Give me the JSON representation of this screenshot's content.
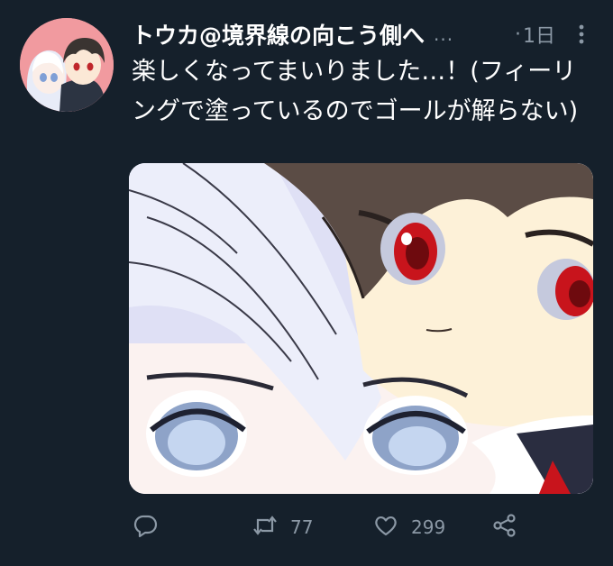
{
  "tweet": {
    "author_name": "トウカ@境界線の向こう側へ",
    "name_overflow": "...",
    "separator": "·",
    "time": "1日",
    "text": "楽しくなってまいりました…！(フィーリングで塗っているのでゴールが解らない)"
  },
  "actions": {
    "reply_count": "",
    "retweet_count": "77",
    "like_count": "299"
  },
  "icons": [
    "more-icon",
    "reply-icon",
    "retweet-icon",
    "like-icon",
    "share-icon"
  ],
  "colors": {
    "background": "#15202b",
    "muted": "#8b98a5",
    "avatar_bg": "#f19a9f"
  }
}
